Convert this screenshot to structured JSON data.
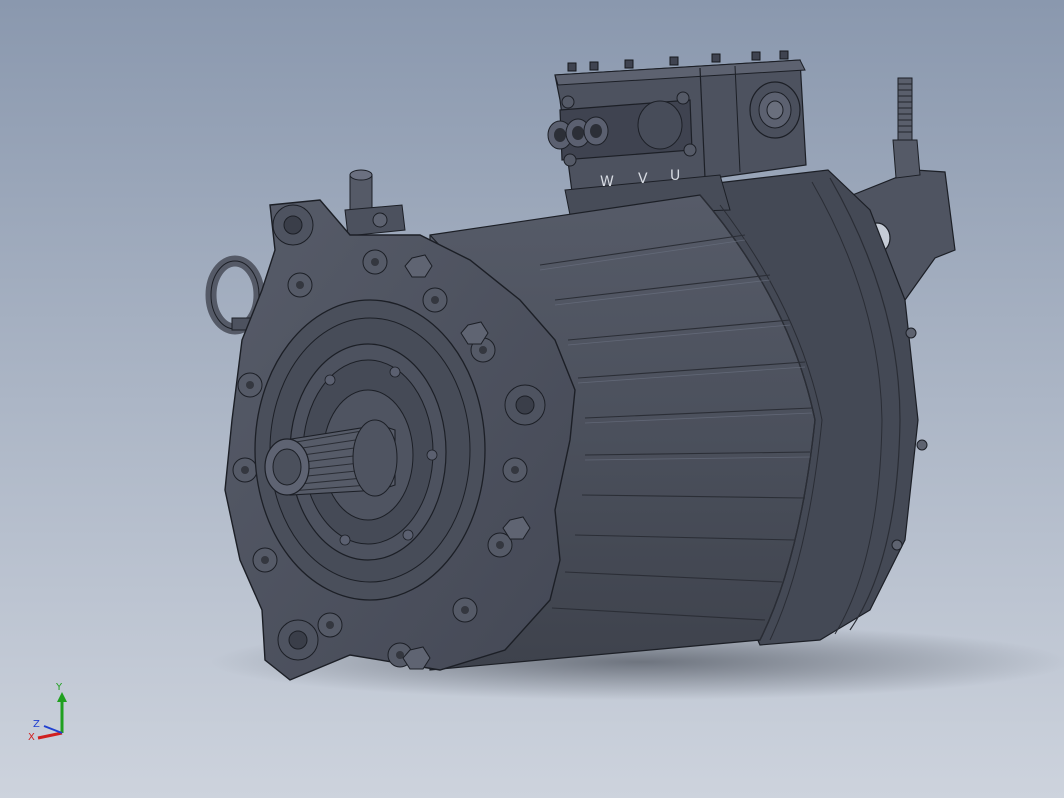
{
  "viewport": {
    "background_top": "#8a98ae",
    "background_bottom": "#cdd3dd"
  },
  "model": {
    "body_color": "#4a4f5b",
    "edge_color": "#1c1f26",
    "highlight_color": "#6b7180"
  },
  "terminal_labels": [
    "W",
    "V",
    "U"
  ],
  "triad": {
    "x_label": "X",
    "y_label": "Y",
    "z_label": "Z",
    "x_color": "#d02020",
    "y_color": "#20a020",
    "z_color": "#2040d0"
  }
}
